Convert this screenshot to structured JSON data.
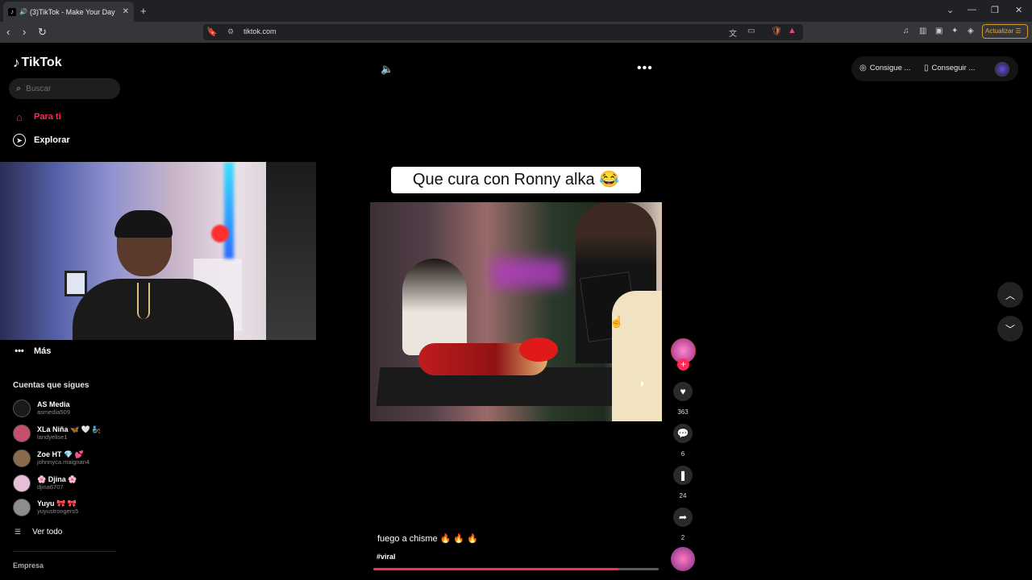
{
  "browser": {
    "tab_title": "(3)TikTok - Make Your Day",
    "tab_close": "✕",
    "new_tab": "+",
    "url": "tiktok.com",
    "update_label": "Actualizar"
  },
  "sidebar": {
    "logo": "TikTok",
    "search_placeholder": "Buscar",
    "nav": [
      {
        "label": "Para ti",
        "icon": "home-icon"
      },
      {
        "label": "Explorar",
        "icon": "compass-icon"
      }
    ],
    "more_label": "Más",
    "following_title": "Cuentas que sigues",
    "accounts": [
      {
        "name": "AS Media",
        "handle": "asmedia509"
      },
      {
        "name": "XLa Niña 🦋 🤍 🧞",
        "handle": "landyelise1"
      },
      {
        "name": "Zoe HT 💎 💕",
        "handle": "johnnyca.maignan4"
      },
      {
        "name": "🌸 Djina 🌸",
        "handle": "djina6707"
      },
      {
        "name": "Yuyu 🎀 🎀",
        "handle": "yuyustrongers5"
      }
    ],
    "see_all": "Ver todo",
    "company": "Empresa"
  },
  "video": {
    "overlay_caption": "Que cura con Ronny alka 😂",
    "description": "fuego a chisme 🔥 🔥 🔥",
    "hashtag": "#viral",
    "progress_fraction": 0.86,
    "likes": "363",
    "comments": "6",
    "saves": "24",
    "shares": "2"
  },
  "topright": {
    "coins_label": "Consigue ...",
    "app_label": "Conseguir ..."
  },
  "colors": {
    "accent": "#fe2c55",
    "background": "#000000"
  }
}
